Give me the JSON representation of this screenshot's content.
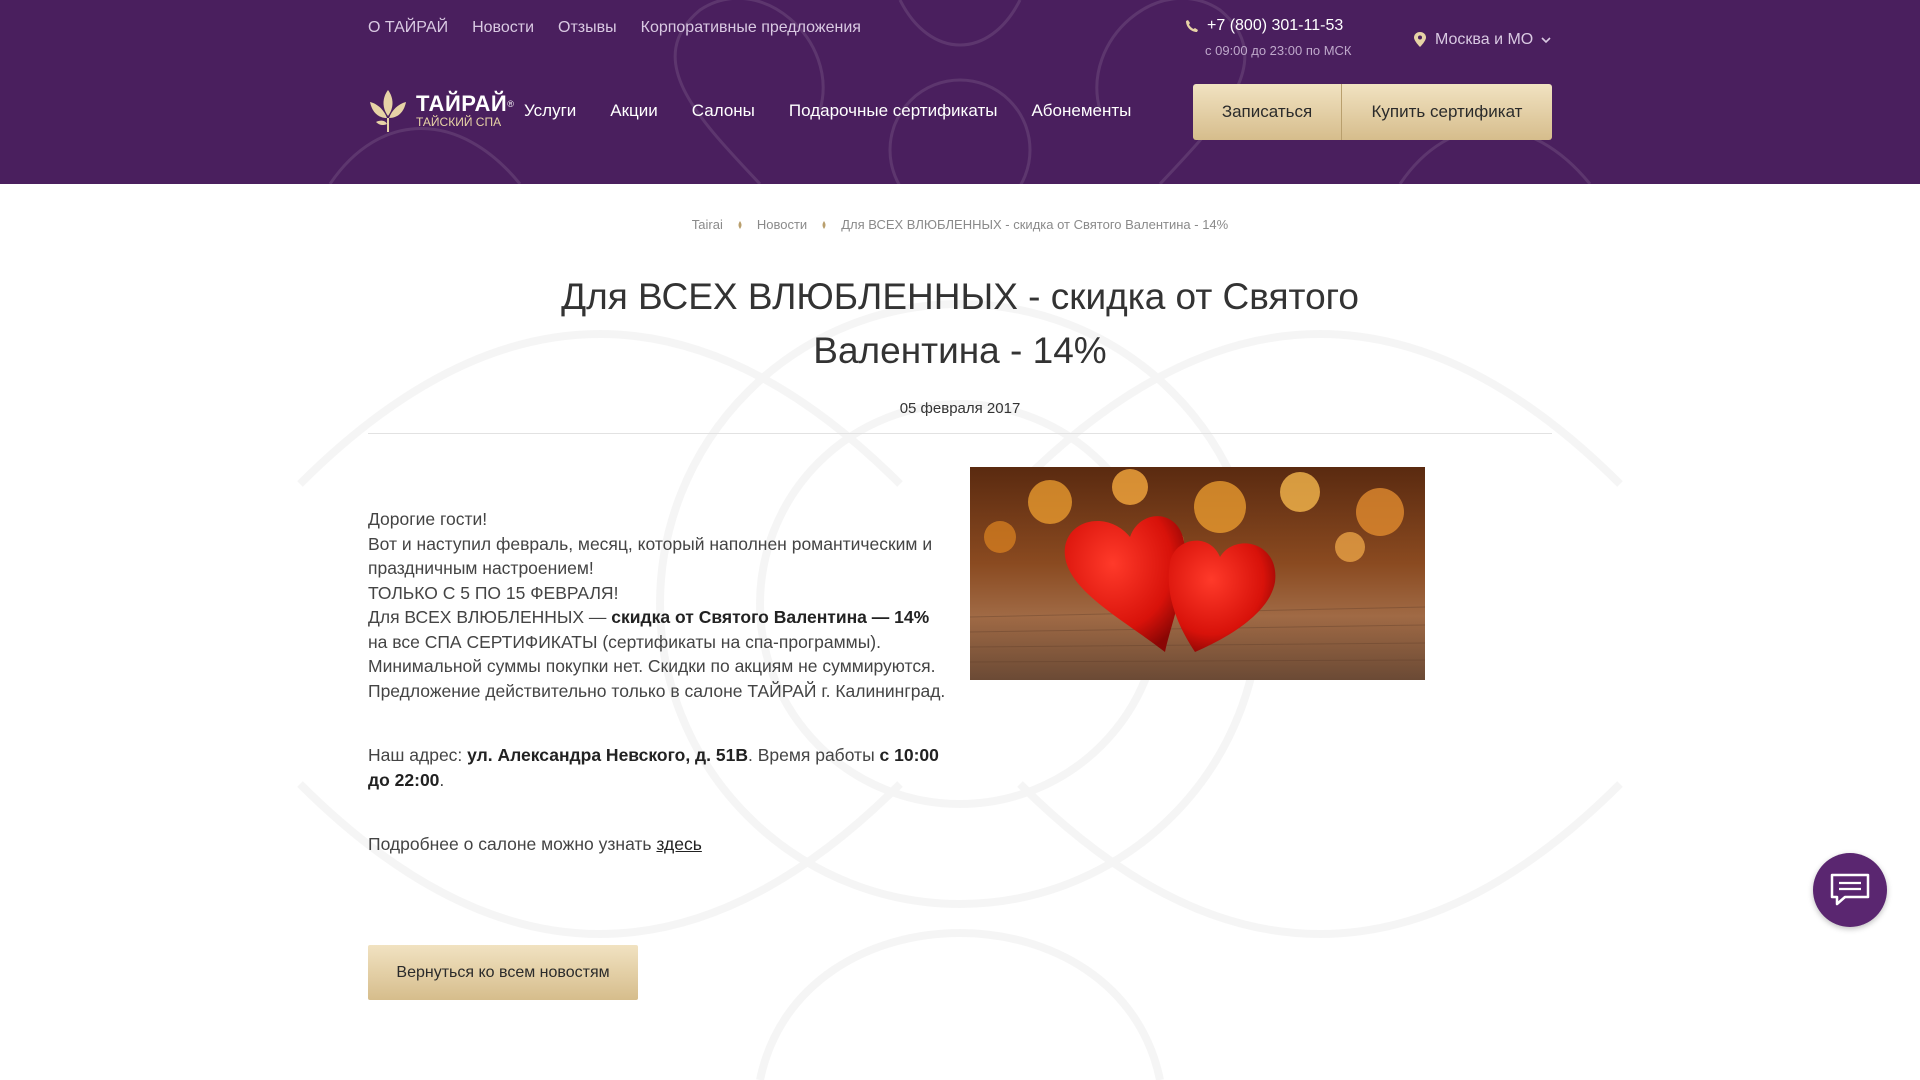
{
  "header": {
    "top_links": [
      "О ТАЙРАЙ",
      "Новости",
      "Отзывы",
      "Корпоративные предложения"
    ],
    "phone": "+7 (800) 301-11-53",
    "phone_hours": "с 09:00 до 23:00 по МСК",
    "city": "Москва и МО",
    "logo_title": "ТАЙРАЙ",
    "logo_subtitle": "ТАЙСКИЙ СПА",
    "main_nav": [
      "Услуги",
      "Акции",
      "Салоны",
      "Подарочные сертификаты",
      "Абонементы"
    ],
    "signup_label": "Записаться",
    "buy_label": "Купить сертификат"
  },
  "breadcrumb": [
    "Tairai",
    "Новости",
    "Для ВСЕХ ВЛЮБЛЕННЫХ - скидка от Святого Валентина - 14%"
  ],
  "page": {
    "title": "Для ВСЕХ ВЛЮБЛЕННЫХ - скидка от Святого Валентина - 14%",
    "date": "05 февраля 2017"
  },
  "article": {
    "greeting": "Дорогие гости!",
    "line1": "Вот и наступил февраль, месяц, который наполнен романтическим и праздничным настроением!",
    "line2": "ТОЛЬКО С 5 ПО 15 ФЕВРАЛЯ!",
    "line3_pre": "Для ВСЕХ ВЛЮБЛЕННЫХ — ",
    "line3_bold": "скидка от Святого Валентина — 14%",
    "line3_post": " на все СПА СЕРТИФИКАТЫ (сертификаты на спа-программы).",
    "line4": "Минимальной суммы покупки нет. Скидки по акциям не суммируются.",
    "line5": "Предложение действительно только в салоне ТАЙРАЙ г. Калининград.",
    "address_pre": "Наш адрес: ",
    "address_bold": "ул. Александра Невского, д. 51В",
    "hours_pre": ". Время работы ",
    "hours_bold": "с 10:00 до 22:00",
    "hours_post": ".",
    "more_pre": "Подробнее о салоне можно узнать ",
    "more_link": "здесь"
  },
  "back_button": "Вернуться ко всем новостям",
  "colors": {
    "header_bg": "#4a1f5e",
    "gold_light": "#f1e2c1",
    "gold_dark": "#d6bd8c",
    "chat_bg": "#5a2670"
  },
  "icons": [
    "phone-icon",
    "map-pin-icon",
    "chevron-down-icon",
    "lotus-logo-icon",
    "chat-icon"
  ]
}
